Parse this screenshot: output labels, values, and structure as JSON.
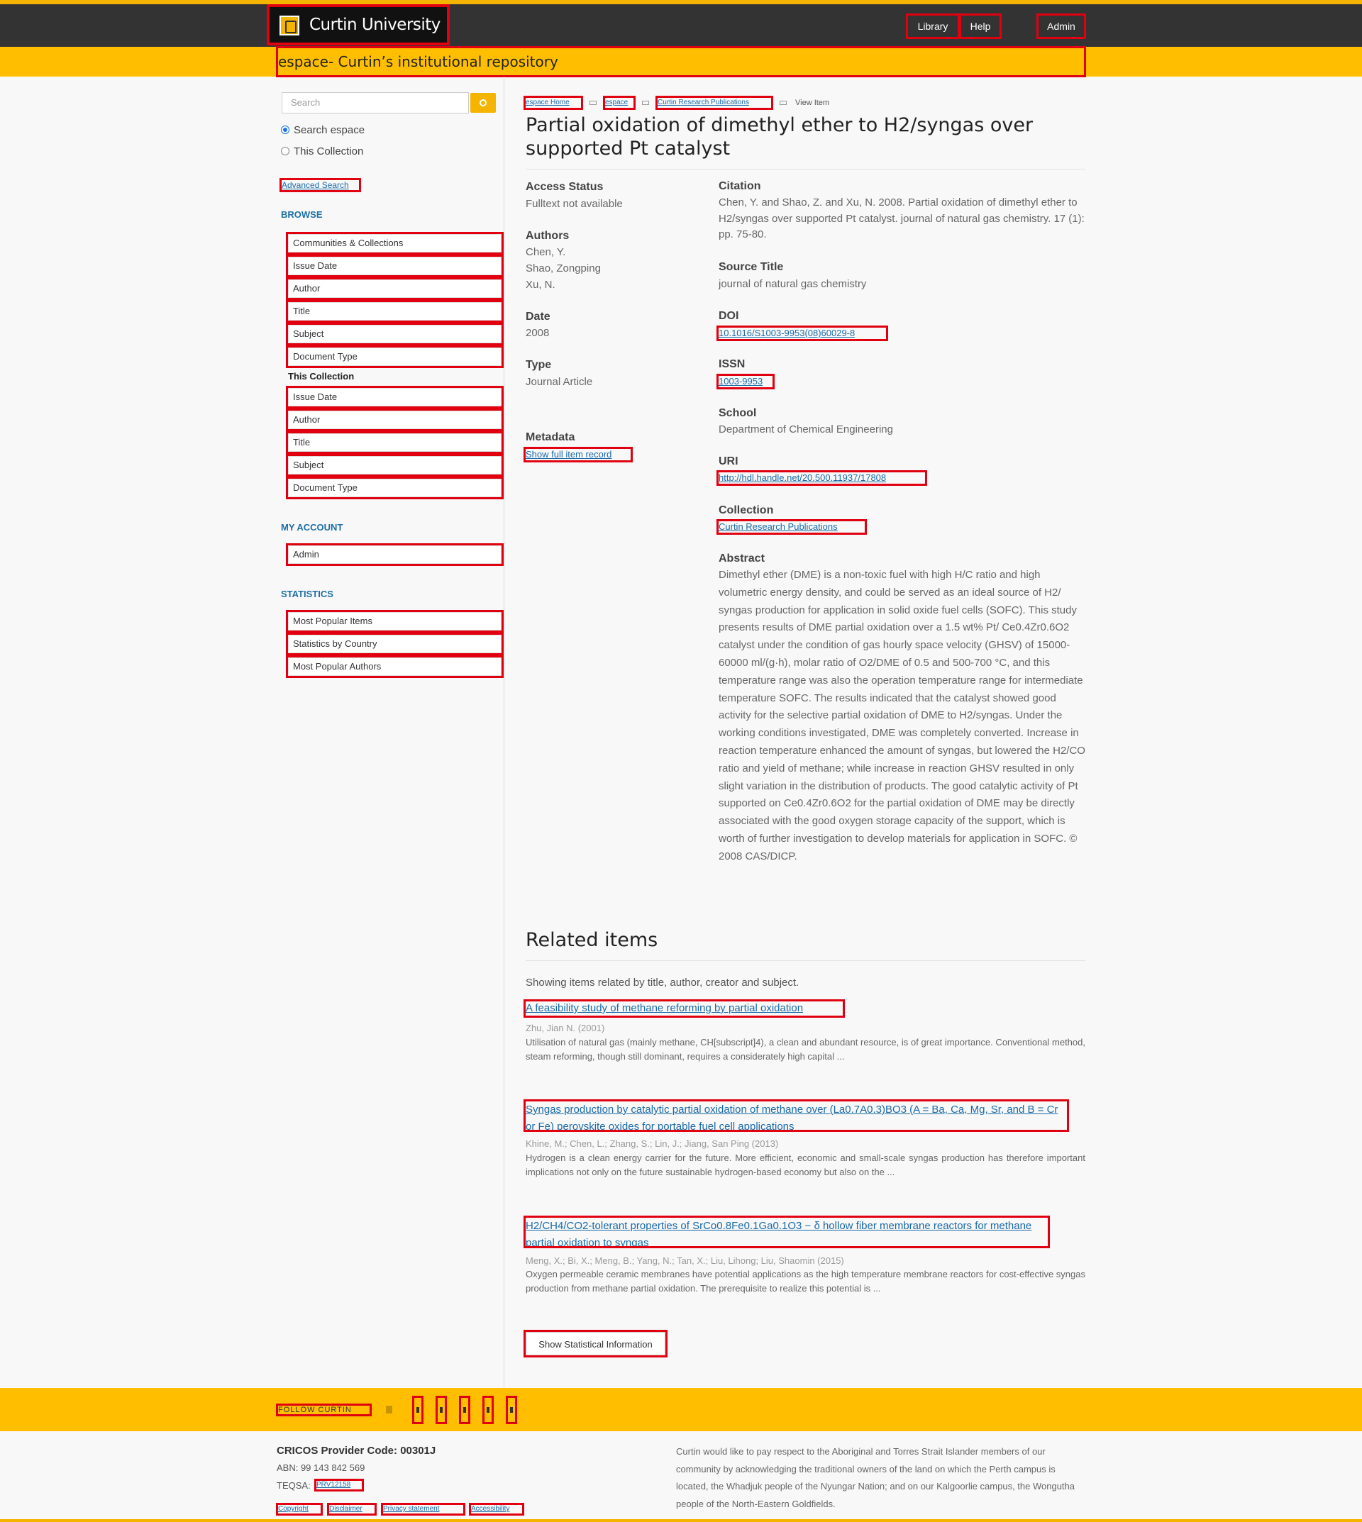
{
  "header": {
    "logo_text": "Curtin University",
    "nav": {
      "library": "Library",
      "help": "Help",
      "admin": "Admin"
    },
    "repository_title": "espace- Curtin’s institutional repository"
  },
  "sidebar": {
    "search_placeholder": "Search",
    "scope_options": [
      "Search espace",
      "This Collection"
    ],
    "selected_scope": "Search espace",
    "advanced_search": "Advanced Search",
    "browse_heading": "BROWSE",
    "browse_items": [
      "Communities & Collections",
      "Issue Date",
      "Author",
      "Title",
      "Subject",
      "Document Type"
    ],
    "this_collection_heading": "This Collection",
    "collection_items": [
      "Issue Date",
      "Author",
      "Title",
      "Subject",
      "Document Type"
    ],
    "account_heading": "MY ACCOUNT",
    "account_items": [
      "Admin"
    ],
    "statistics_heading": "STATISTICS",
    "statistics_items": [
      "Most Popular Items",
      "Statistics by Country",
      "Most Popular Authors"
    ]
  },
  "breadcrumbs": [
    "espace Home",
    "espace",
    "Curtin Research Publications",
    "View Item"
  ],
  "item": {
    "title": "Partial oxidation of dimethyl ether to H2/syngas over supported Pt catalyst",
    "access_status_label": "Access Status",
    "access_status": "Fulltext not available",
    "authors_label": "Authors",
    "authors": [
      "Chen, Y.",
      "Shao, Zongping",
      "Xu, N."
    ],
    "date_label": "Date",
    "date": "2008",
    "type_label": "Type",
    "type": "Journal Article",
    "metadata_label": "Metadata",
    "metadata_link": "Show full item record",
    "citation_label": "Citation",
    "citation": "Chen, Y. and Shao, Z. and Xu, N. 2008. Partial oxidation of dimethyl ether to H2/syngas over supported Pt catalyst. journal of natural gas chemistry. 17 (1): pp. 75-80.",
    "source_title_label": "Source Title",
    "source_title": "journal of natural gas chemistry",
    "doi_label": "DOI",
    "doi": "10.1016/S1003-9953(08)60029-8",
    "issn_label": "ISSN",
    "issn": "1003-9953",
    "school_label": "School",
    "school": "Department of Chemical Engineering",
    "uri_label": "URI",
    "uri": "http://hdl.handle.net/20.500.11937/17808",
    "collection_label": "Collection",
    "collection": "Curtin Research Publications",
    "abstract_label": "Abstract",
    "abstract": "Dimethyl ether (DME) is a non-toxic fuel with high H/C ratio and high volumetric energy density, and could be served as an ideal source of H2/ syngas production for application in solid oxide fuel cells (SOFC). This study presents results of DME partial oxidation over a 1.5 wt% Pt/ Ce0.4Zr0.6O2 catalyst under the condition of gas hourly space velocity (GHSV) of 15000-60000 ml/(g·h), molar ratio of O2/DME of 0.5 and 500-700 °C, and this temperature range was also the operation temperature range for intermediate temperature SOFC. The results indicated that the catalyst showed good activity for the selective partial oxidation of DME to H2/syngas. Under the working conditions investigated, DME was completely converted. Increase in reaction temperature enhanced the amount of syngas, but lowered the H2/CO ratio and yield of methane; while increase in reaction GHSV resulted in only slight variation in the distribution of products. The good catalytic activity of Pt supported on Ce0.4Zr0.6O2 for the partial oxidation of DME may be directly associated with the good oxygen storage capacity of the support, which is worth of further investigation to develop materials for application in SOFC. © 2008 CAS/DICP."
  },
  "related": {
    "heading": "Related items",
    "intro": "Showing items related by title, author, creator and subject.",
    "items": [
      {
        "title": "A feasibility study of methane reforming by partial oxidation",
        "meta": "Zhu, Jian N. (2001)",
        "abstract": "Utilisation of natural gas (mainly methane, CH[subscript]4), a clean and abundant resource, is of great importance. Conventional method, steam reforming, though still dominant, requires a considerately high capital ..."
      },
      {
        "title": "Syngas production by catalytic partial oxidation of methane over (La0.7A0.3)BO3 (A = Ba, Ca, Mg, Sr, and B = Cr or Fe) perovskite oxides for portable fuel cell applications",
        "meta": "Khine, M.; Chen, L.; Zhang, S.; Lin, J.; Jiang, San Ping (2013)",
        "abstract": "Hydrogen is a clean energy carrier for the future. More efficient, economic and small-scale syngas production has therefore important implications not only on the future sustainable hydrogen-based economy but also on the ..."
      },
      {
        "title": "H2/CH4/CO2-tolerant properties of SrCo0.8Fe0.1Ga0.1O3 − δ hollow fiber membrane reactors for methane partial oxidation to syngas",
        "meta": "Meng, X.; Bi, X.; Meng, B.; Yang, N.; Tan, X.; Liu, Lihong; Liu, Shaomin (2015)",
        "abstract": "Oxygen permeable ceramic membranes have potential applications as the high temperature membrane reactors for cost-effective syngas production from methane partial oxidation. The prerequisite to realize this potential is ..."
      }
    ],
    "stat_button": "Show Statistical Information"
  },
  "footer": {
    "follow": "FOLLOW CURTIN",
    "cricos": "CRICOS Provider Code: 00301J",
    "abn": "ABN: 99 143 842 569",
    "teqsa_label": "TEQSA:",
    "teqsa_link": "PRV12158",
    "links": [
      "Copyright",
      "Disclaimer",
      "Privacy statement",
      "Accessibility"
    ],
    "acknowledgement": "Curtin would like to pay respect to the Aboriginal and Torres Strait Islander members of our community by acknowledging the traditional owners of the land on which the Perth campus is located, the Whadjuk people of the Nyungar Nation; and on our Kalgoorlie campus, the Wongutha people of the North-Eastern Goldfields."
  },
  "colors": {
    "accent": "#ffbf00",
    "header_bg": "#333333",
    "link": "#1a6aa8",
    "annotation": "#e00010"
  }
}
